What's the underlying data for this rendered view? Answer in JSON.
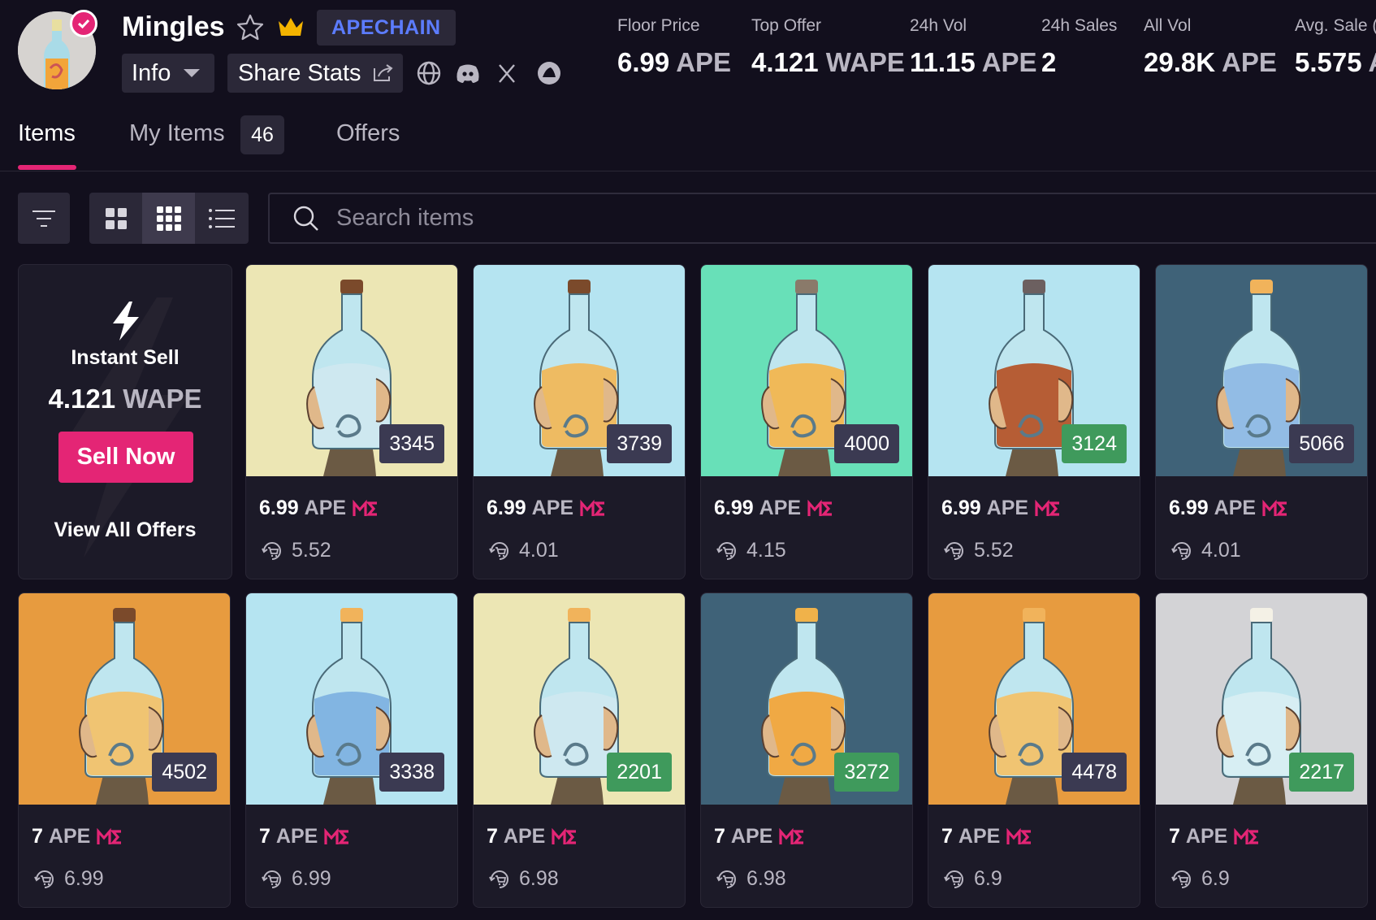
{
  "collection": {
    "name": "Mingles",
    "chain": "APECHAIN"
  },
  "actions": {
    "info_label": "Info",
    "share_label": "Share Stats"
  },
  "stats": [
    {
      "label": "Floor Price",
      "value": "6.99",
      "unit": "APE"
    },
    {
      "label": "Top Offer",
      "value": "4.121",
      "unit": "WAPE"
    },
    {
      "label": "24h Vol",
      "value": "11.15",
      "unit": "APE"
    },
    {
      "label": "24h Sales",
      "value": "2",
      "unit": ""
    },
    {
      "label": "All Vol",
      "value": "29.8K",
      "unit": "APE"
    },
    {
      "label": "Avg. Sale (",
      "value": "5.575",
      "unit": "A"
    }
  ],
  "tabs": {
    "items": "Items",
    "my_items": "My Items",
    "my_items_count": "46",
    "offers": "Offers"
  },
  "search": {
    "placeholder": "Search items"
  },
  "instant_sell": {
    "label": "Instant Sell",
    "price": "4.121",
    "unit": "WAPE",
    "button": "Sell Now",
    "view_all": "View All Offers"
  },
  "cards": [
    {
      "id": "3345",
      "price": "6.99",
      "unit": "APE",
      "offer": "5.52",
      "bg": "#ece6b4",
      "liquid": "#cfe8ef",
      "cap": "#7b4a2b",
      "badge": "#3b3a52"
    },
    {
      "id": "3739",
      "price": "6.99",
      "unit": "APE",
      "offer": "4.01",
      "bg": "#b5e4f1",
      "liquid": "#f0b85a",
      "cap": "#7b4a2b",
      "badge": "#3b3a52"
    },
    {
      "id": "4000",
      "price": "6.99",
      "unit": "APE",
      "offer": "4.15",
      "bg": "#68e0b8",
      "liquid": "#f2b64f",
      "cap": "#8a7a6a",
      "badge": "#3b3a52"
    },
    {
      "id": "3124",
      "price": "6.99",
      "unit": "APE",
      "offer": "5.52",
      "bg": "#b5e4f1",
      "liquid": "#b5552a",
      "cap": "#6c6060",
      "badge": "#3f9a5c"
    },
    {
      "id": "5066",
      "price": "6.99",
      "unit": "APE",
      "offer": "4.01",
      "bg": "#3f6278",
      "liquid": "#8fb9e4",
      "cap": "#f1b35b",
      "badge": "#3b3a52"
    },
    {
      "id": "4502",
      "price": "7",
      "unit": "APE",
      "offer": "6.99",
      "bg": "#e79b3f",
      "liquid": "#f2c26a",
      "cap": "#7b4a2b",
      "badge": "#3b3a52"
    },
    {
      "id": "3338",
      "price": "7",
      "unit": "APE",
      "offer": "6.99",
      "bg": "#b5e4f1",
      "liquid": "#7eb2e0",
      "cap": "#f1b35b",
      "badge": "#3b3a52"
    },
    {
      "id": "2201",
      "price": "7",
      "unit": "APE",
      "offer": "6.98",
      "bg": "#ece6b4",
      "liquid": "#cfe8ef",
      "cap": "#f1b35b",
      "badge": "#3f9a5c"
    },
    {
      "id": "3272",
      "price": "7",
      "unit": "APE",
      "offer": "6.98",
      "bg": "#3f6278",
      "liquid": "#f2a53a",
      "cap": "#f0b24a",
      "badge": "#3f9a5c"
    },
    {
      "id": "4478",
      "price": "7",
      "unit": "APE",
      "offer": "6.9",
      "bg": "#e79b3f",
      "liquid": "#f2c26a",
      "cap": "#f1b35b",
      "badge": "#3b3a52"
    },
    {
      "id": "2217",
      "price": "7",
      "unit": "APE",
      "offer": "6.9",
      "bg": "#d3d3d6",
      "liquid": "#d8eef2",
      "cap": "#f4f1e6",
      "badge": "#3f9a5c"
    }
  ],
  "colors": {
    "accent": "#e42575",
    "chain": "#5c7cff",
    "background": "#120f1d"
  }
}
